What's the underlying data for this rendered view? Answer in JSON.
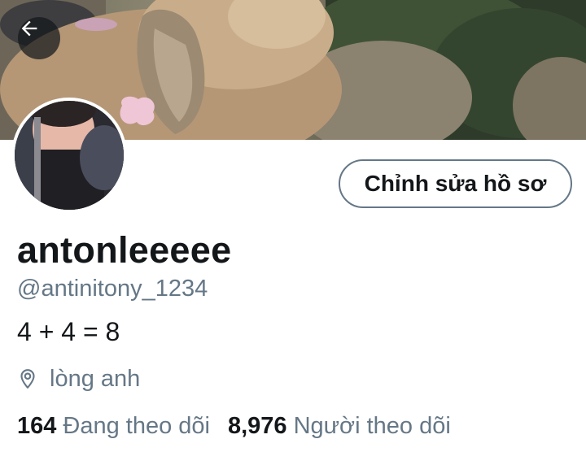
{
  "header": {
    "back_icon": "arrow-left-icon"
  },
  "profile": {
    "edit_label": "Chỉnh sửa hồ sơ",
    "display_name": "antonleeeee",
    "handle": "@antinitony_1234",
    "bio": "4 + 4 = 8",
    "location_icon": "location-pin-icon",
    "location": "lòng anh"
  },
  "stats": {
    "following_count": "164",
    "following_label": "Đang theo dõi",
    "followers_count": "8,976",
    "followers_label": "Người theo dõi"
  },
  "colors": {
    "text_primary": "#14171a",
    "text_secondary": "#657786",
    "border": "#657786"
  }
}
